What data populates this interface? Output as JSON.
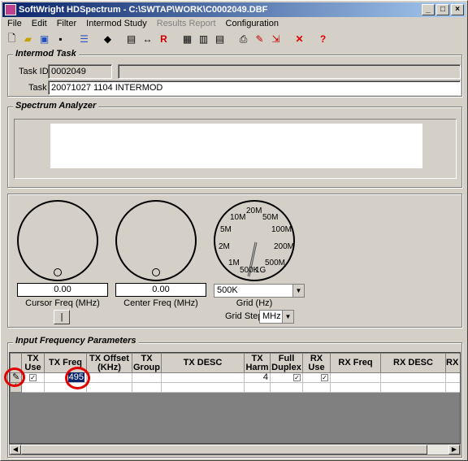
{
  "window": {
    "title": "SoftWright HDSpectrum - C:\\SWTAP\\WORK\\C0002049.DBF"
  },
  "menu": [
    "File",
    "Edit",
    "Filter",
    "Intermod Study",
    "Results Report",
    "Configuration"
  ],
  "intermod_task": {
    "title": "Intermod Task",
    "task_id_label": "Task ID:",
    "task_id": "0002049",
    "task_id_extra": "",
    "task_label": "Task",
    "task": "20071027 1104 INTERMOD"
  },
  "spectrum": {
    "title": "Spectrum Analyzer"
  },
  "dials": {
    "cursor_value": "0.00",
    "cursor_caption": "Cursor Freq (MHz)",
    "center_value": "0.00",
    "center_caption": "Center Freq (MHz)",
    "cursor_button": "|",
    "grid_value": "500K",
    "grid_caption": "Grid (Hz)",
    "grid_step_label": "Grid Step",
    "grid_step_value": "MHz",
    "grid_scale": [
      "20M",
      "50M",
      "10M",
      "100M",
      "5M",
      "200M",
      "2M",
      "500M",
      "1M",
      "1G",
      "500K"
    ]
  },
  "input_params": {
    "title": "Input Frequency Parameters",
    "columns": [
      {
        "line1": "",
        "line2": ""
      },
      {
        "line1": "TX",
        "line2": "Use"
      },
      {
        "line1": "TX Freq",
        "line2": ""
      },
      {
        "line1": "TX Offset",
        "line2": "(KHz)"
      },
      {
        "line1": "TX",
        "line2": "Group"
      },
      {
        "line1": "TX DESC",
        "line2": ""
      },
      {
        "line1": "TX",
        "line2": "Harm"
      },
      {
        "line1": "Full",
        "line2": "Duplex"
      },
      {
        "line1": "RX",
        "line2": "Use"
      },
      {
        "line1": "RX Freq",
        "line2": ""
      },
      {
        "line1": "RX DESC",
        "line2": ""
      },
      {
        "line1": "RX",
        "line2": ""
      }
    ],
    "row1": {
      "marker": "✎",
      "tx_freq": "495",
      "tx_harm": "4"
    },
    "row2": {
      "marker": "*"
    }
  },
  "colors": {
    "highlight_ring": "#e00000",
    "title_bar": "#0a246a"
  }
}
